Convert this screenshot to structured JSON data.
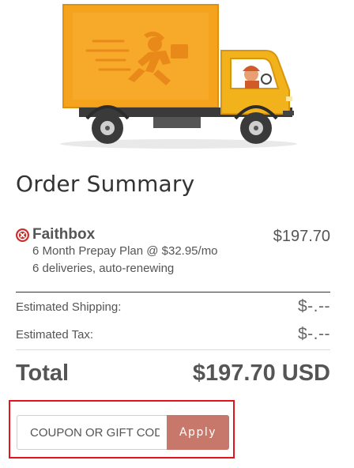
{
  "summary": {
    "title": "Order Summary"
  },
  "item": {
    "name": "Faithbox",
    "plan": "6 Month Prepay Plan @ $32.95/mo",
    "deliveries": "6 deliveries, auto-renewing",
    "price": "$197.70",
    "remove_icon": "close-circle-icon"
  },
  "fees": {
    "shipping_label": "Estimated Shipping:",
    "shipping_value": "$-.--",
    "tax_label": "Estimated Tax:",
    "tax_value": "$-.--"
  },
  "total": {
    "label": "Total",
    "value": "$197.70 USD"
  },
  "coupon": {
    "placeholder": "COUPON OR GIFT CODE",
    "apply_label": "Apply"
  },
  "colors": {
    "truck_body": "#f5a21c",
    "cab": "#f2b21b",
    "remove": "#c6302c",
    "apply_button": "#c8786a",
    "highlight_border": "#e3141c"
  }
}
